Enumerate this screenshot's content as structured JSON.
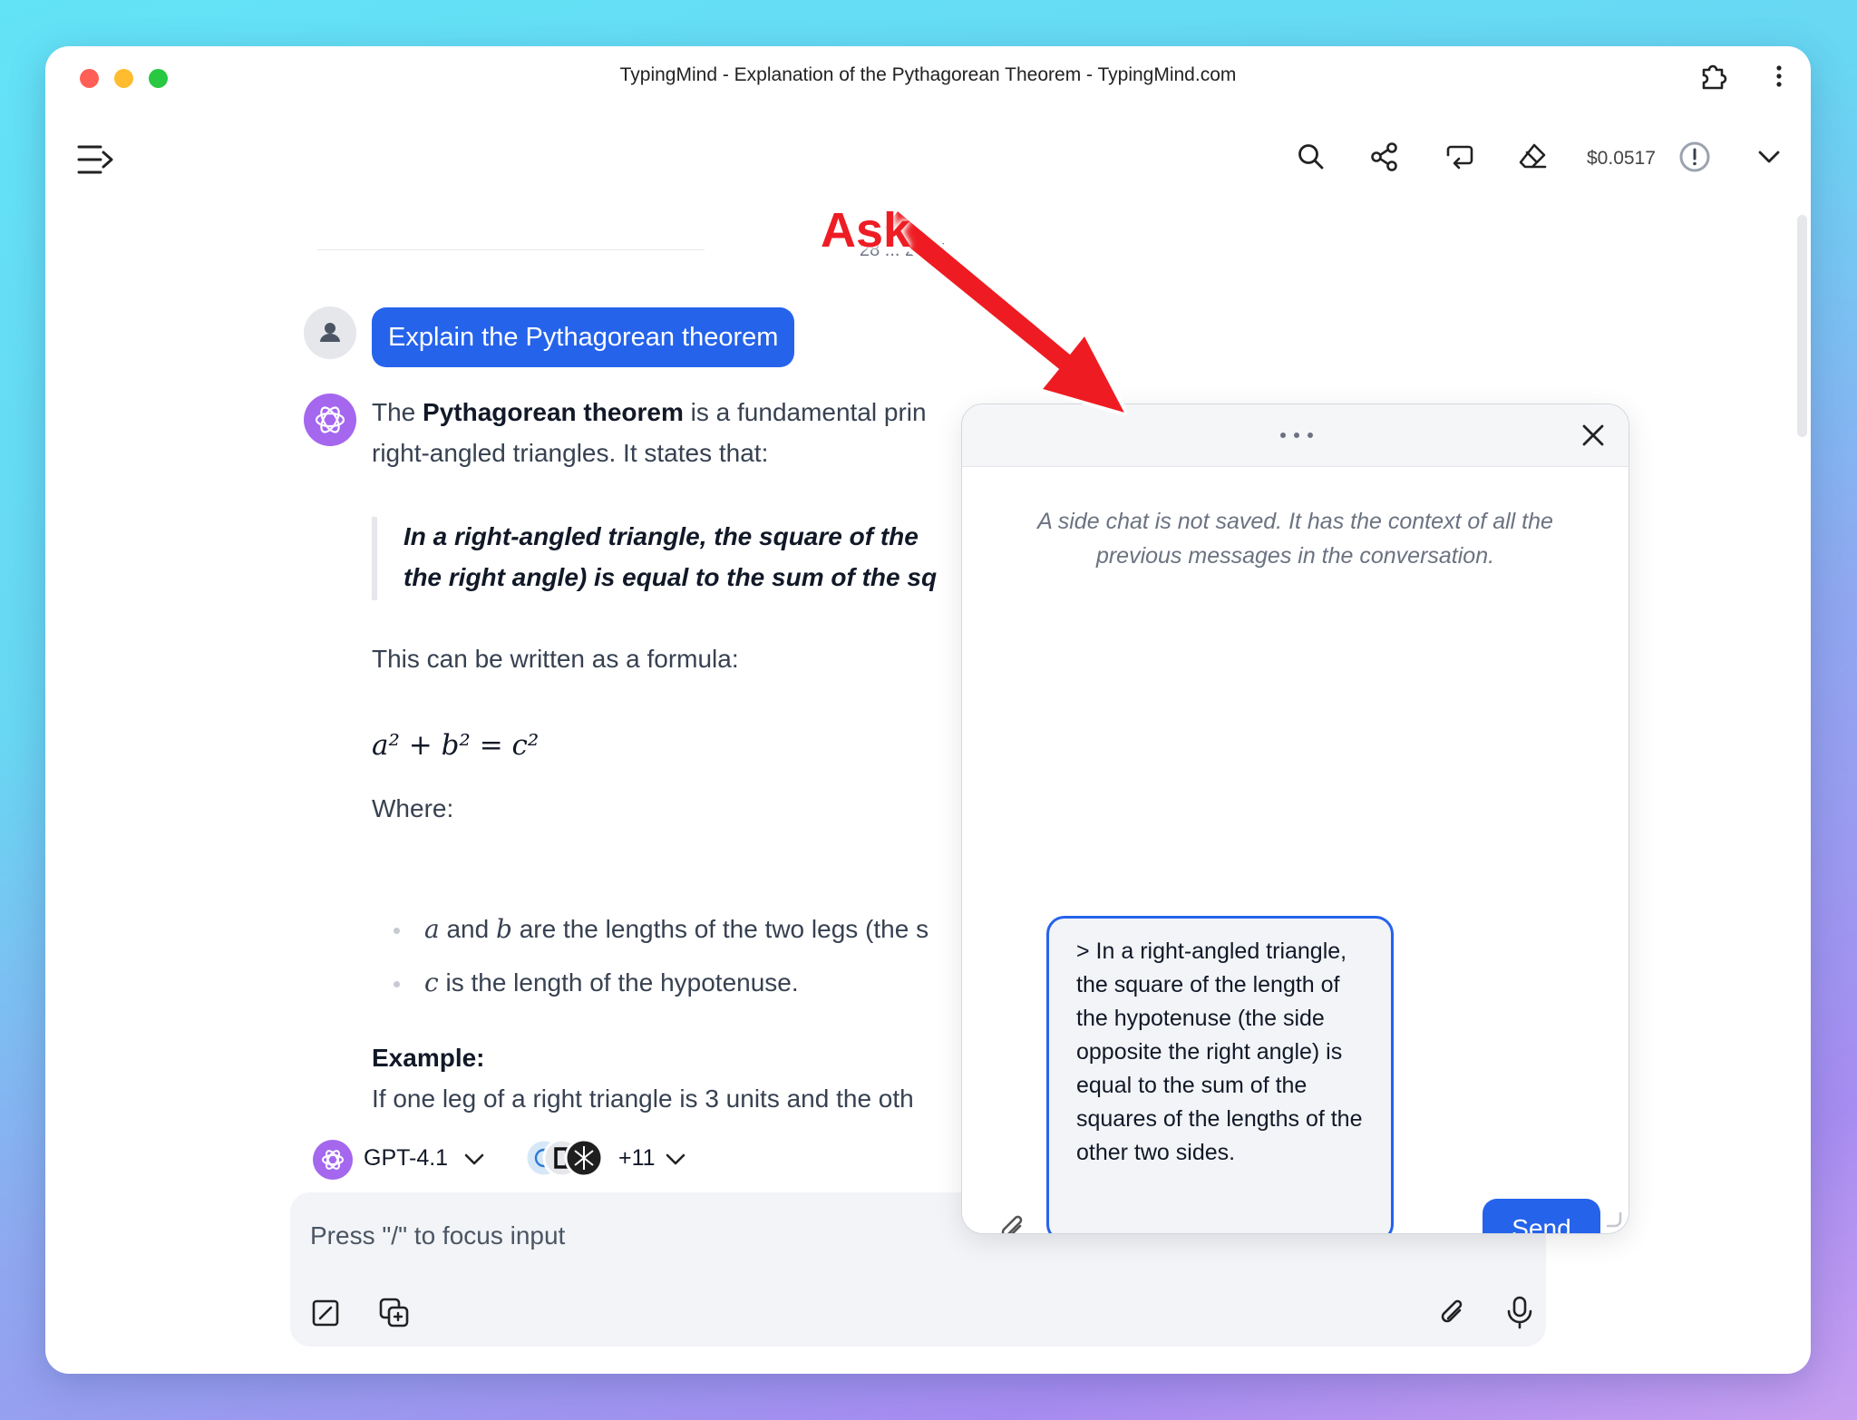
{
  "window": {
    "title": "TypingMind - Explanation of the Pythagorean Theorem - TypingMind.com",
    "traffic_colors": [
      "#ff5f57",
      "#febc2e",
      "#28c840"
    ]
  },
  "toolbar": {
    "cost": "$0.0517",
    "icons": [
      "search-icon",
      "share-icon",
      "branch-icon",
      "eraser-icon",
      "alert-icon",
      "chevron-down-icon"
    ]
  },
  "chat": {
    "date_label": "28 ... 2025",
    "user_message": "Explain the Pythagorean theorem",
    "intro_pre": "The ",
    "intro_bold": "Pythagorean theorem",
    "intro_post": " is a fundamental prin",
    "intro_line2": "right-angled triangles. It states that:",
    "quote_line1": "In a right-angled triangle, the square of the",
    "quote_line2": "the right angle) is equal to the sum of the sq",
    "formula_intro": "This can be written as a formula:",
    "formula": "a² + b² = c²",
    "where": "Where:",
    "bullet1_a": "a",
    "bullet1_and": " and ",
    "bullet1_b": "b",
    "bullet1_rest": " are the lengths of the two legs (the s",
    "bullet2_c": "c",
    "bullet2_rest": " is the length of the hypotenuse.",
    "example_title": "Example:",
    "example_text": "If one leg of a right triangle is 3 units and the oth"
  },
  "composer": {
    "model_name": "GPT-4.1",
    "plugins_count": "+11",
    "placeholder": "Press \"/\" to focus input"
  },
  "side_chat": {
    "note": "A side chat is not saved. It has the context of all the previous messages in the conversation.",
    "input_value": "> In a right-angled triangle, the square of the length of the hypotenuse (the side opposite the right angle) is equal to the sum of the squares of the lengths of the other two sides.",
    "send_label": "Send"
  },
  "annotation": {
    "label": "Ask",
    "color": "#ee1d24"
  }
}
